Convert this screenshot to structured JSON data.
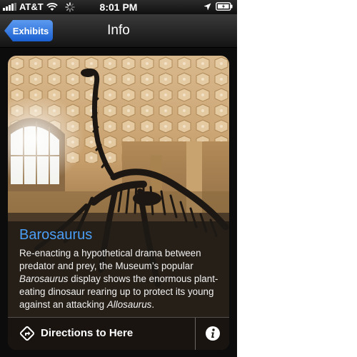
{
  "status_bar": {
    "carrier": "AT&T",
    "time": "8:01 PM"
  },
  "nav": {
    "back_label": "Exhibits",
    "title": "Info"
  },
  "exhibit": {
    "title": "Barosaurus",
    "desc_1": "Re-enacting a hypothetical drama between predator and prey, the Museum’s popular ",
    "desc_italic_1": "Barosaurus",
    "desc_2": " display shows the enormous plant-eating dinosaur rearing up to protect its young against an attacking ",
    "desc_italic_2": "Allosaurus",
    "desc_3": "."
  },
  "actions": {
    "directions_label": "Directions to Here"
  },
  "colors": {
    "accent_blue": "#4b9ef5",
    "back_button": "#1a5fd0"
  },
  "icons": [
    "signal-icon",
    "wifi-icon",
    "activity-spinner-icon",
    "location-arrow-icon",
    "battery-icon",
    "directions-icon",
    "info-icon"
  ]
}
